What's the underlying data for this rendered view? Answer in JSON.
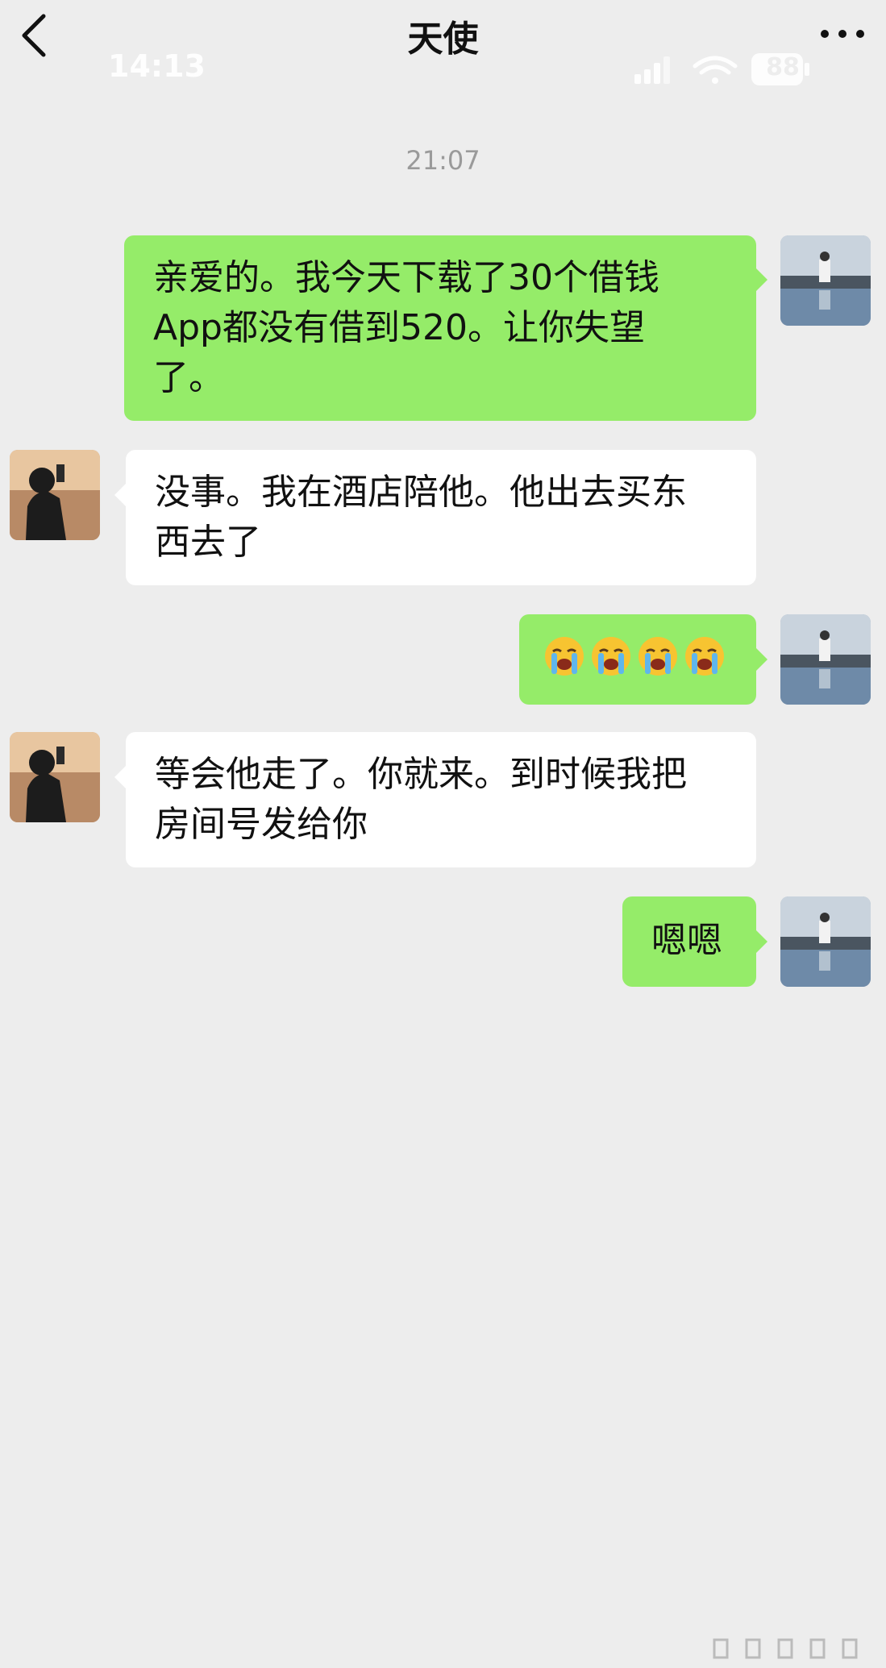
{
  "header": {
    "title": "天使",
    "back_icon": "chevron-left-icon",
    "more_icon": "more-dots-icon"
  },
  "status_bar": {
    "time": "14:13",
    "battery": "88",
    "icons": [
      "signal-icon",
      "wifi-icon",
      "battery-icon"
    ]
  },
  "chat": {
    "timestamp": "21:07",
    "messages": [
      {
        "sender": "me",
        "text_lines": [
          "亲爱的。我今天下载了30个借钱",
          "App都没有借到520。让你失望",
          "了。"
        ]
      },
      {
        "sender": "them",
        "text_lines": [
          "没事。我在酒店陪他。他出去买东",
          "西去了"
        ]
      },
      {
        "sender": "me",
        "emoji": "loudly-crying-face",
        "emoji_count": 4
      },
      {
        "sender": "them",
        "text_lines": [
          "等会他走了。你就来。到时候我把",
          "房间号发给你"
        ]
      },
      {
        "sender": "me",
        "text_lines": [
          "嗯嗯"
        ]
      }
    ]
  },
  "colors": {
    "background": "#ededed",
    "my_bubble": "#95ec69",
    "their_bubble": "#ffffff",
    "timestamp": "#9a9a9a"
  }
}
